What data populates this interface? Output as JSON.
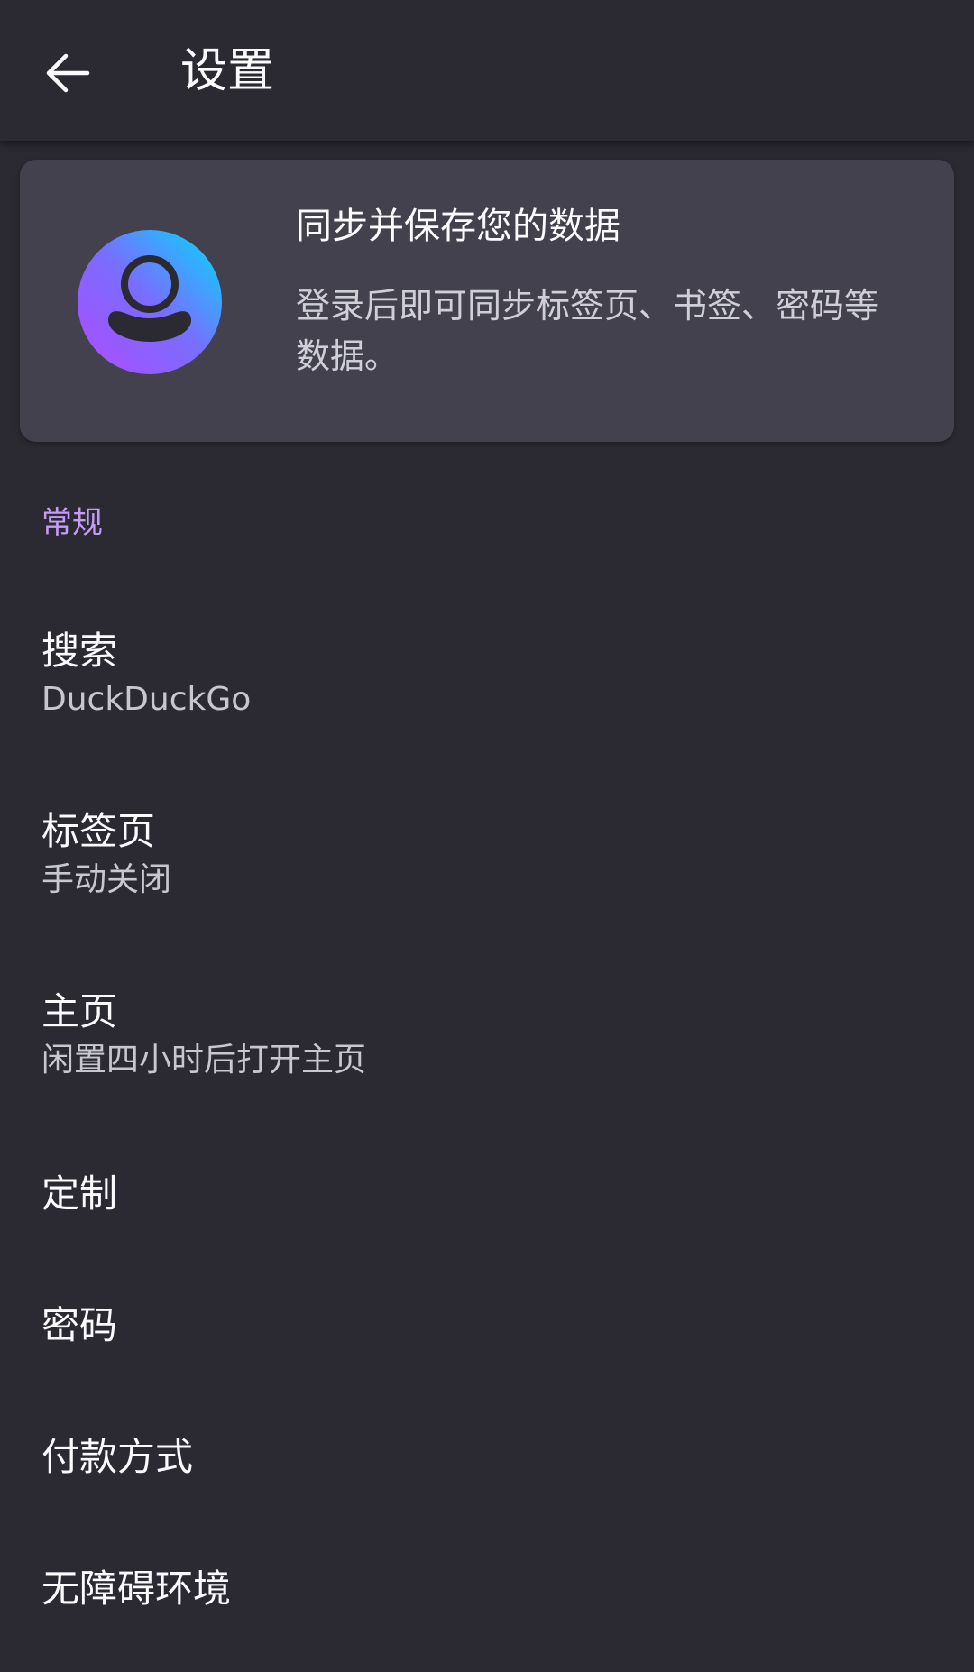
{
  "appbar": {
    "back_icon": "arrow-left-icon",
    "title": "设置"
  },
  "account": {
    "avatar_icon": "account-avatar-icon",
    "title": "同步并保存您的数据",
    "description": "登录后即可同步标签页、书签、密码等数据。"
  },
  "section": {
    "header": "常规"
  },
  "items": [
    {
      "title": "搜索",
      "summary": "DuckDuckGo"
    },
    {
      "title": "标签页",
      "summary": "手动关闭"
    },
    {
      "title": "主页",
      "summary": "闲置四小时后打开主页"
    },
    {
      "title": "定制"
    },
    {
      "title": "密码"
    },
    {
      "title": "付款方式"
    },
    {
      "title": "无障碍环境"
    }
  ],
  "colors": {
    "background": "#2b2a33",
    "card": "#42414d",
    "accent": "#c69bf8",
    "avatar_gradient_start": "#00ddff",
    "avatar_gradient_end": "#9059ff"
  }
}
